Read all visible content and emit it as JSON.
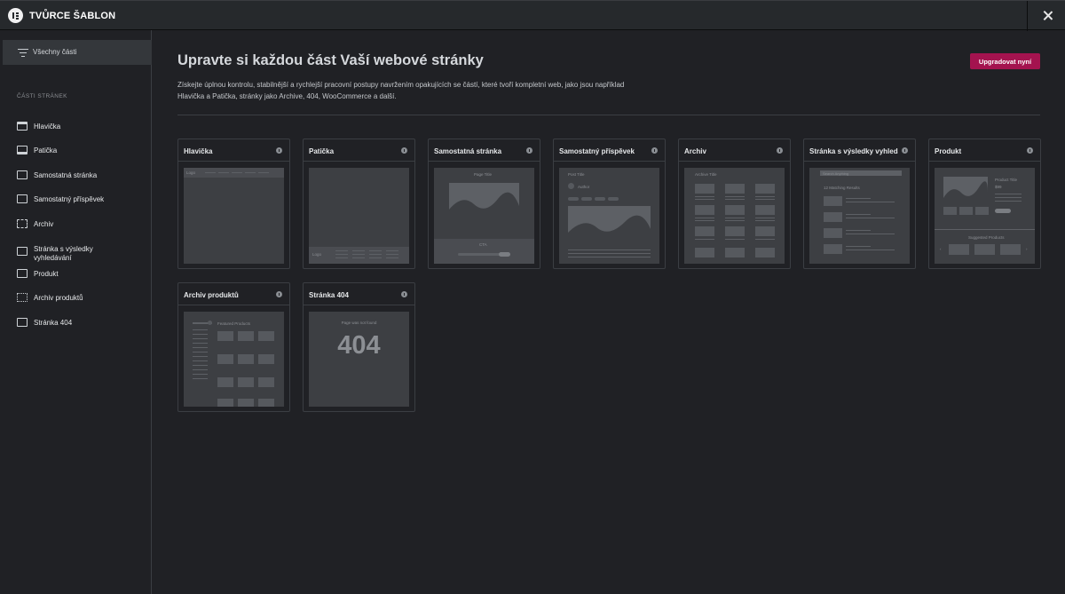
{
  "app": {
    "title": "TVŮRCE ŠABLON"
  },
  "sidebar": {
    "all_parts": "Všechny části",
    "section_heading": "ČÁSTI STRÁNEK",
    "items": [
      {
        "label": "Hlavička",
        "icon": "header-icon"
      },
      {
        "label": "Patička",
        "icon": "footer-icon"
      },
      {
        "label": "Samostatná stránka",
        "icon": "single-page-icon"
      },
      {
        "label": "Samostatný příspěvek",
        "icon": "single-post-icon"
      },
      {
        "label": "Archiv",
        "icon": "archive-icon"
      },
      {
        "label": "Stránka s výsledky vyhledávání",
        "icon": "search-results-icon"
      },
      {
        "label": "Produkt",
        "icon": "product-icon"
      },
      {
        "label": "Archiv produktů",
        "icon": "product-archive-icon"
      },
      {
        "label": "Stránka 404",
        "icon": "error-404-icon"
      }
    ]
  },
  "main": {
    "title": "Upravte si každou část Vaší webové stránky",
    "upgrade_label": "Upgradovat nyní",
    "description_line1": "Získejte úplnou kontrolu, stabilnější a rychlejší pracovní postupy navržením opakujících se částí, které tvoří kompletní web, jako jsou například",
    "description_line2": "Hlavička a Patička, stránky jako Archive, 404, WooCommerce a další.",
    "cards": [
      {
        "name": "Hlavička"
      },
      {
        "name": "Patička"
      },
      {
        "name": "Samostatná stránka"
      },
      {
        "name": "Samostatný příspěvek"
      },
      {
        "name": "Archiv"
      },
      {
        "name": "Stránka s výsledky vyhledá..."
      },
      {
        "name": "Produkt"
      },
      {
        "name": "Archiv produktů"
      },
      {
        "name": "Stránka 404"
      }
    ],
    "thumb_text": {
      "logo": "Logo",
      "page_title": "Page Title",
      "cta": "CTA",
      "post_title": "Post Title",
      "author": "Author",
      "archive_title": "Archive Title",
      "search_placeholder": "Search Anything",
      "matching_results": "12 Matching Results",
      "product_title": "Product Title",
      "price": "$99",
      "suggested_products": "Suggested Products",
      "featured_products": "Featured Products",
      "page_not_found": "Page was not found",
      "error_code": "404"
    }
  },
  "colors": {
    "accent": "#a4134f",
    "background": "#202125",
    "panel": "#26292c"
  }
}
